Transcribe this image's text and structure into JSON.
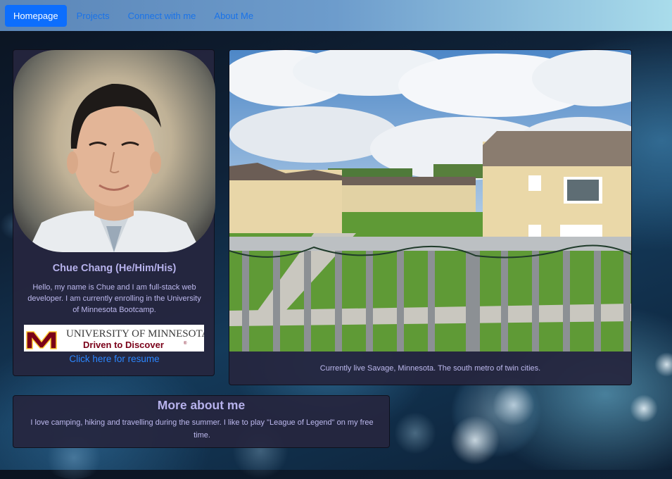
{
  "nav": {
    "items": [
      {
        "label": "Homepage",
        "active": true
      },
      {
        "label": "Projects",
        "active": false
      },
      {
        "label": "Connect with me",
        "active": false
      },
      {
        "label": "About Me",
        "active": false
      }
    ]
  },
  "profile": {
    "photo_icon": "profile-photo",
    "name": "Chue Chang (He/Him/His)",
    "bio": "Hello, my name is Chue and I am full-stack web developer. I am currently enrolling in the University of Minnesota Bootcamp.",
    "logo": {
      "line1": "UNIVERSITY OF MINNESOTA",
      "line2": "Driven to Discover",
      "trademark": "®",
      "brand_color": "#7a0019",
      "accent_color": "#ffcc33"
    },
    "resume_link": "Click here for resume"
  },
  "photo": {
    "caption": "Currently live Savage, Minnesota. The south metro of twin cities."
  },
  "about": {
    "title": "More about me",
    "text": "I love camping, hiking and travelling during the summer. I like to play \"League of Legend\" on my free time."
  },
  "colors": {
    "nav_active": "#0d6efd",
    "link": "#1a73e8",
    "card_bg": "#26263e",
    "text": "#bdb9ee",
    "heading": "#b7b2ec"
  }
}
